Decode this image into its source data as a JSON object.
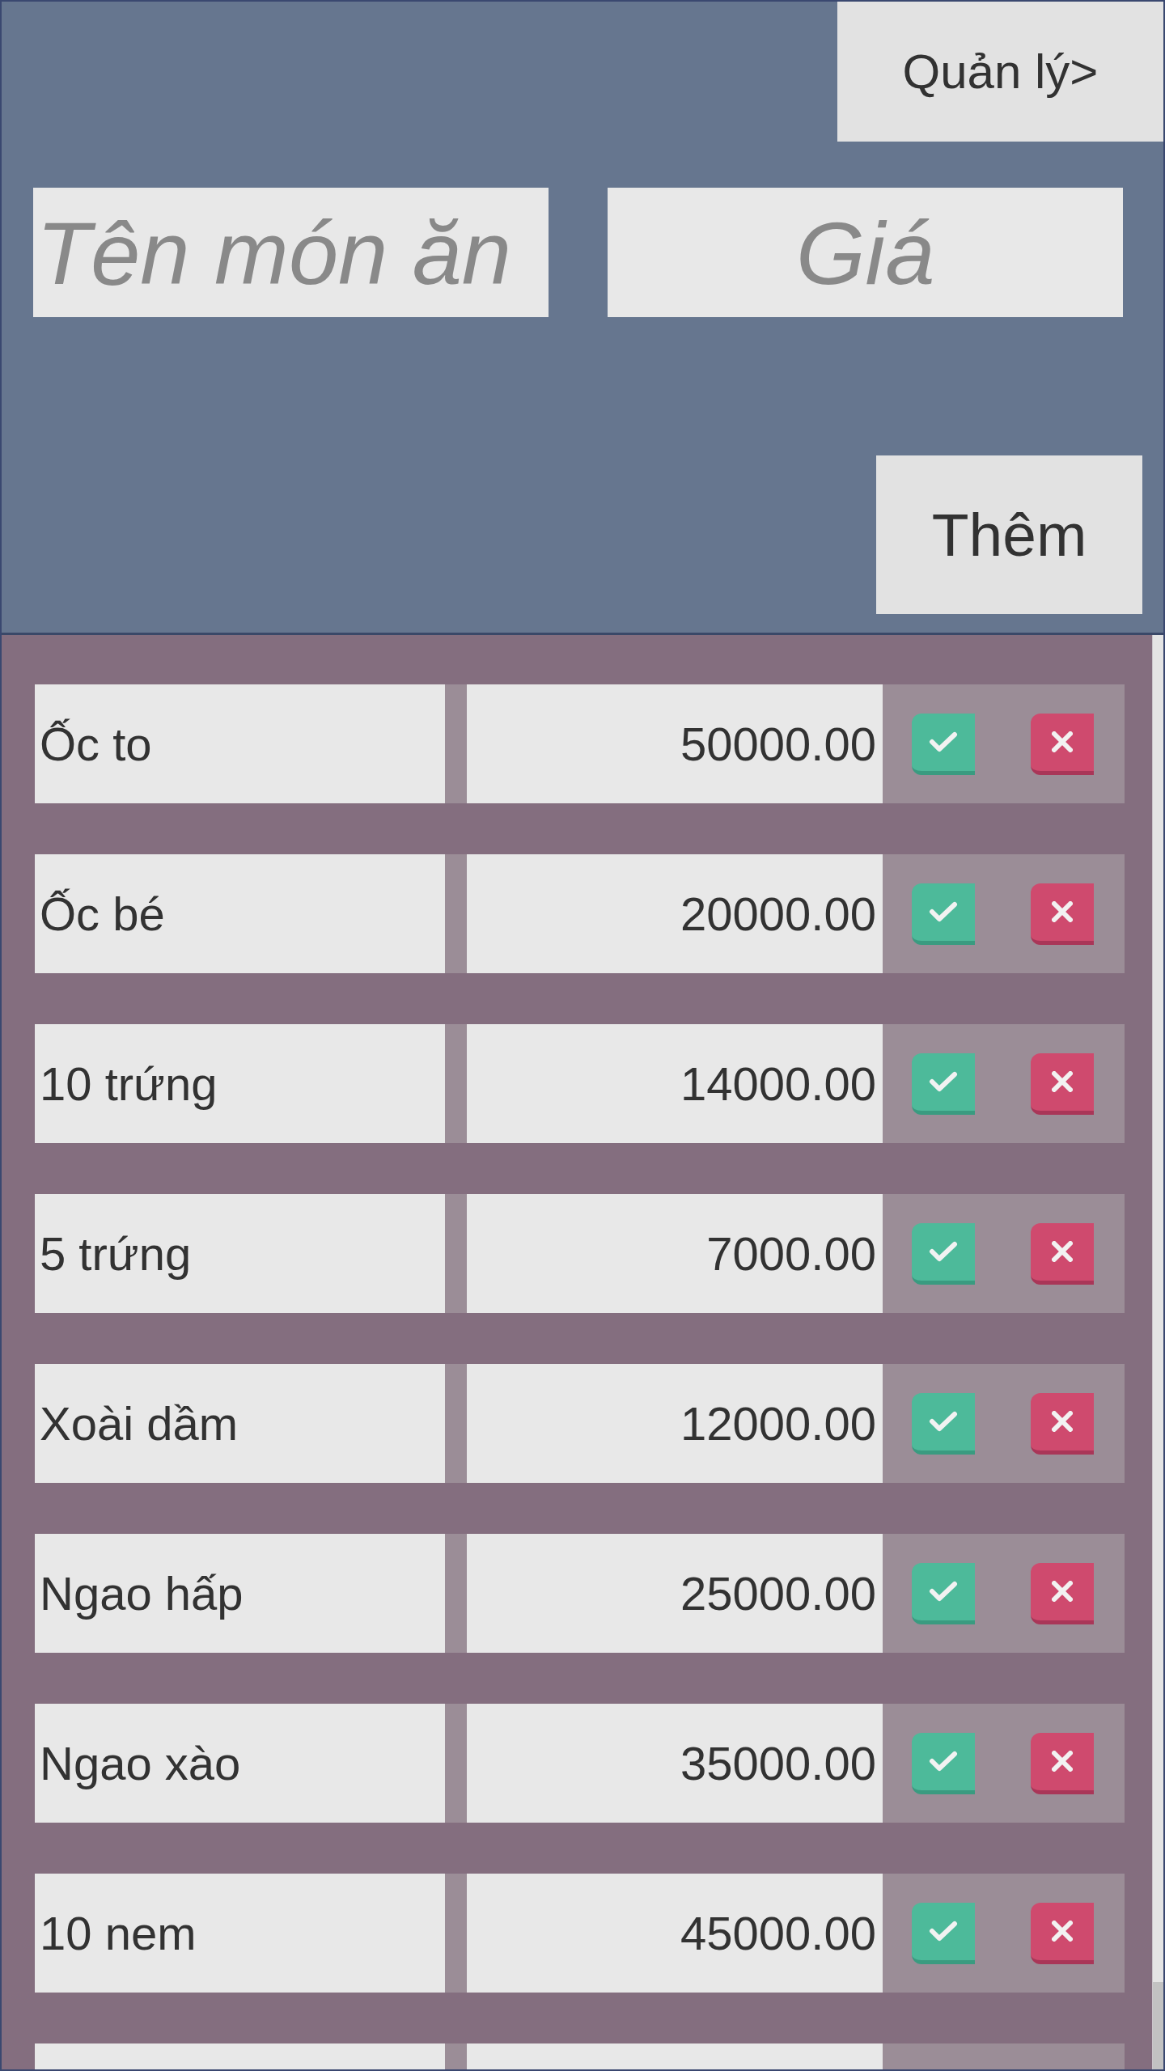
{
  "header": {
    "manage_button": "Quản lý>",
    "name_input": {
      "placeholder": "Tên món ăn"
    },
    "price_input": {
      "placeholder": "Giá"
    },
    "add_button": "Thêm"
  },
  "rows": [
    {
      "name": "Ốc to",
      "price": "50000.00"
    },
    {
      "name": "Ốc bé",
      "price": "20000.00"
    },
    {
      "name": "10 trứng",
      "price": "14000.00"
    },
    {
      "name": "5 trứng",
      "price": "7000.00"
    },
    {
      "name": "Xoài dầm",
      "price": "12000.00"
    },
    {
      "name": "Ngao hấp",
      "price": "25000.00"
    },
    {
      "name": "Ngao xào",
      "price": "35000.00"
    },
    {
      "name": "10 nem",
      "price": "45000.00"
    },
    {}
  ]
}
